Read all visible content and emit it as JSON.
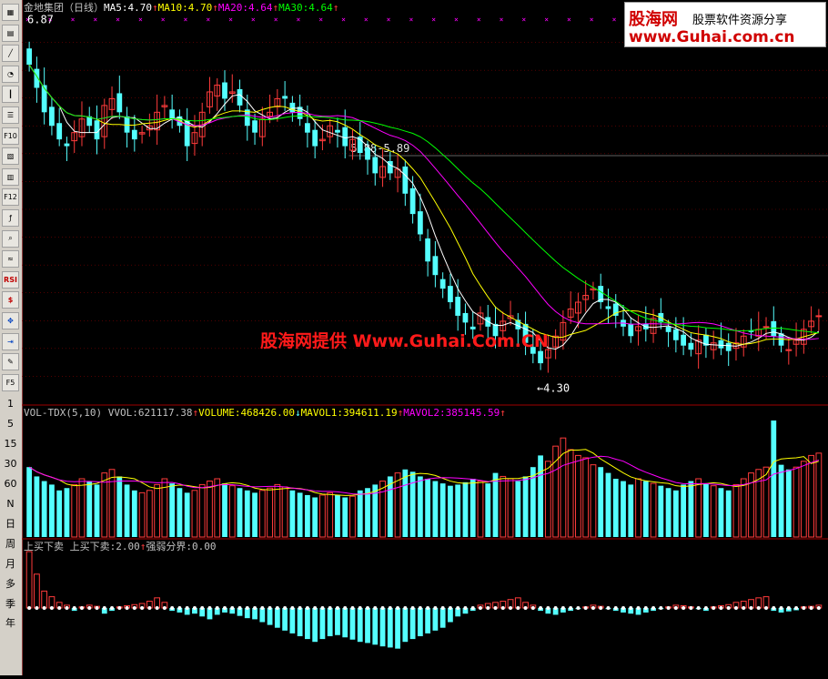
{
  "toolbar": {
    "icons": [
      "grid-icon",
      "table-icon",
      "line-chart-icon",
      "pie-icon",
      "candle-icon",
      "list-icon",
      "f10-icon",
      "doc-icon",
      "notes-icon",
      "f12-icon",
      "formula-icon",
      "search-icon",
      "indicator-icon",
      "rsi-icon",
      "dollar-icon",
      "move-icon",
      "export-icon",
      "pencil-icon",
      "f5-icon"
    ],
    "labels": {
      "rsi": "RSI",
      "f10": "F10",
      "f12": "F12",
      "f5": "F5"
    },
    "periods": [
      "1",
      "5",
      "15",
      "30",
      "60",
      "N",
      "日",
      "周",
      "月",
      "多",
      "季",
      "年"
    ]
  },
  "main_panel": {
    "stock_name": "金地集团（日线）",
    "ma_legend": [
      {
        "label": "MA5:",
        "value": "4.70",
        "arrow": "↑",
        "color": "#ffffff"
      },
      {
        "label": "MA10:",
        "value": "4.70",
        "arrow": "↑",
        "color": "#ffff00"
      },
      {
        "label": "MA20:",
        "value": "4.64",
        "arrow": "↑",
        "color": "#ff00ff"
      },
      {
        "label": "MA30:",
        "value": "4.64",
        "arrow": "↑",
        "color": "#00ff00"
      }
    ],
    "high_label": "6.87",
    "low_label": "←4.30",
    "resistance_label": "5.88-5.89",
    "watermark": "股海网提供 Www.Guhai.Com.CN"
  },
  "logo": {
    "brand": "股海网",
    "slogan": "股票软件资源分享",
    "url": "www.Guhai.com.cn"
  },
  "volume_panel": {
    "legend": [
      {
        "text": "VOL-TDX(5,10) VVOL:",
        "value": "621117.38",
        "arrow": "↑",
        "color": "#c0c0c0"
      },
      {
        "text": "VOLUME:",
        "value": "468426.00",
        "arrow": "↓",
        "color": "#ffff00"
      },
      {
        "text": "MAVOL1:",
        "value": "394611.19",
        "arrow": "↑",
        "color": "#ffff00"
      },
      {
        "text": "MAVOL2:",
        "value": "385145.59",
        "arrow": "↑",
        "color": "#ff00ff"
      }
    ]
  },
  "indicator_panel": {
    "legend": [
      {
        "text": "上买下卖 上买下卖:",
        "value": "2.00",
        "arrow": "↑",
        "color": "#c0c0c0"
      },
      {
        "text": "强弱分界:",
        "value": "0.00",
        "arrow": "",
        "color": "#c0c0c0"
      }
    ]
  },
  "colors": {
    "up": "#ff3b3b",
    "down": "#54ffff",
    "ma5": "#ffffff",
    "ma10": "#ffff00",
    "ma20": "#ff00ff",
    "ma30": "#00ff00",
    "grid": "#800000",
    "resistance": "#808080"
  },
  "chart_data": {
    "type": "candlestick",
    "price_range": [
      4.3,
      6.87
    ],
    "resistance_level": 5.88,
    "closes": [
      6.55,
      6.38,
      6.2,
      6.1,
      6.0,
      5.95,
      6.05,
      6.15,
      6.1,
      6.0,
      6.25,
      6.3,
      6.2,
      6.05,
      6.0,
      6.05,
      6.1,
      6.2,
      6.25,
      6.15,
      6.1,
      5.95,
      6.05,
      6.2,
      6.35,
      6.4,
      6.3,
      6.35,
      6.25,
      6.1,
      6.05,
      6.15,
      6.2,
      6.3,
      6.3,
      6.2,
      6.15,
      6.05,
      5.95,
      6.0,
      6.1,
      6.05,
      5.95,
      6.0,
      5.9,
      5.85,
      5.75,
      5.8,
      5.75,
      5.78,
      5.6,
      5.45,
      5.3,
      5.1,
      5.0,
      4.9,
      4.8,
      4.7,
      4.65,
      4.6,
      4.72,
      4.62,
      4.55,
      4.66,
      4.7,
      4.6,
      4.5,
      4.42,
      4.35,
      4.45,
      4.55,
      4.65,
      4.75,
      4.8,
      4.85,
      4.9,
      4.8,
      4.75,
      4.7,
      4.62,
      4.55,
      4.62,
      4.6,
      4.68,
      4.65,
      4.58,
      4.52,
      4.48,
      4.45,
      4.52,
      4.48,
      4.5,
      4.46,
      4.44,
      4.5,
      4.55,
      4.58,
      4.6,
      4.62,
      4.55,
      4.48,
      4.45,
      4.52,
      4.6,
      4.66,
      4.7
    ],
    "volume": [
      60,
      52,
      48,
      45,
      40,
      42,
      45,
      50,
      48,
      45,
      55,
      58,
      52,
      45,
      40,
      38,
      40,
      45,
      50,
      46,
      42,
      38,
      40,
      45,
      48,
      50,
      46,
      44,
      42,
      40,
      38,
      40,
      42,
      45,
      43,
      40,
      38,
      36,
      34,
      36,
      38,
      36,
      34,
      35,
      40,
      42,
      45,
      48,
      52,
      55,
      58,
      56,
      52,
      50,
      48,
      46,
      44,
      45,
      47,
      50,
      48,
      46,
      55,
      52,
      50,
      48,
      52,
      60,
      70,
      65,
      78,
      85,
      75,
      70,
      68,
      62,
      60,
      55,
      50,
      48,
      45,
      50,
      48,
      46,
      44,
      42,
      40,
      45,
      48,
      50,
      46,
      44,
      42,
      40,
      45,
      50,
      55,
      58,
      60,
      100,
      62,
      58,
      60,
      65,
      70,
      72
    ],
    "indicator": [
      1.0,
      0.6,
      0.3,
      0.2,
      0.1,
      0.05,
      -0.05,
      0.02,
      0.05,
      0.03,
      -0.1,
      -0.05,
      0.02,
      0.04,
      0.06,
      0.08,
      0.12,
      0.18,
      0.1,
      -0.05,
      -0.08,
      -0.12,
      -0.1,
      -0.15,
      -0.2,
      -0.12,
      -0.08,
      -0.1,
      -0.14,
      -0.18,
      -0.2,
      -0.25,
      -0.3,
      -0.35,
      -0.4,
      -0.45,
      -0.5,
      -0.55,
      -0.6,
      -0.55,
      -0.5,
      -0.48,
      -0.52,
      -0.56,
      -0.6,
      -0.62,
      -0.65,
      -0.68,
      -0.7,
      -0.72,
      -0.6,
      -0.55,
      -0.5,
      -0.45,
      -0.4,
      -0.35,
      -0.25,
      -0.15,
      -0.1,
      -0.05,
      0.05,
      0.08,
      0.1,
      0.12,
      0.15,
      0.18,
      0.1,
      0.05,
      -0.05,
      -0.1,
      -0.12,
      -0.08,
      -0.05,
      -0.02,
      0.02,
      0.05,
      0.03,
      -0.02,
      -0.05,
      -0.08,
      -0.1,
      -0.12,
      -0.08,
      -0.05,
      -0.02,
      0.02,
      0.05,
      0.04,
      0.02,
      -0.02,
      -0.05,
      0.02,
      0.04,
      0.06,
      0.1,
      0.12,
      0.15,
      0.18,
      0.2,
      -0.05,
      -0.08,
      -0.06,
      -0.04,
      0.02,
      0.03,
      0.05
    ]
  }
}
